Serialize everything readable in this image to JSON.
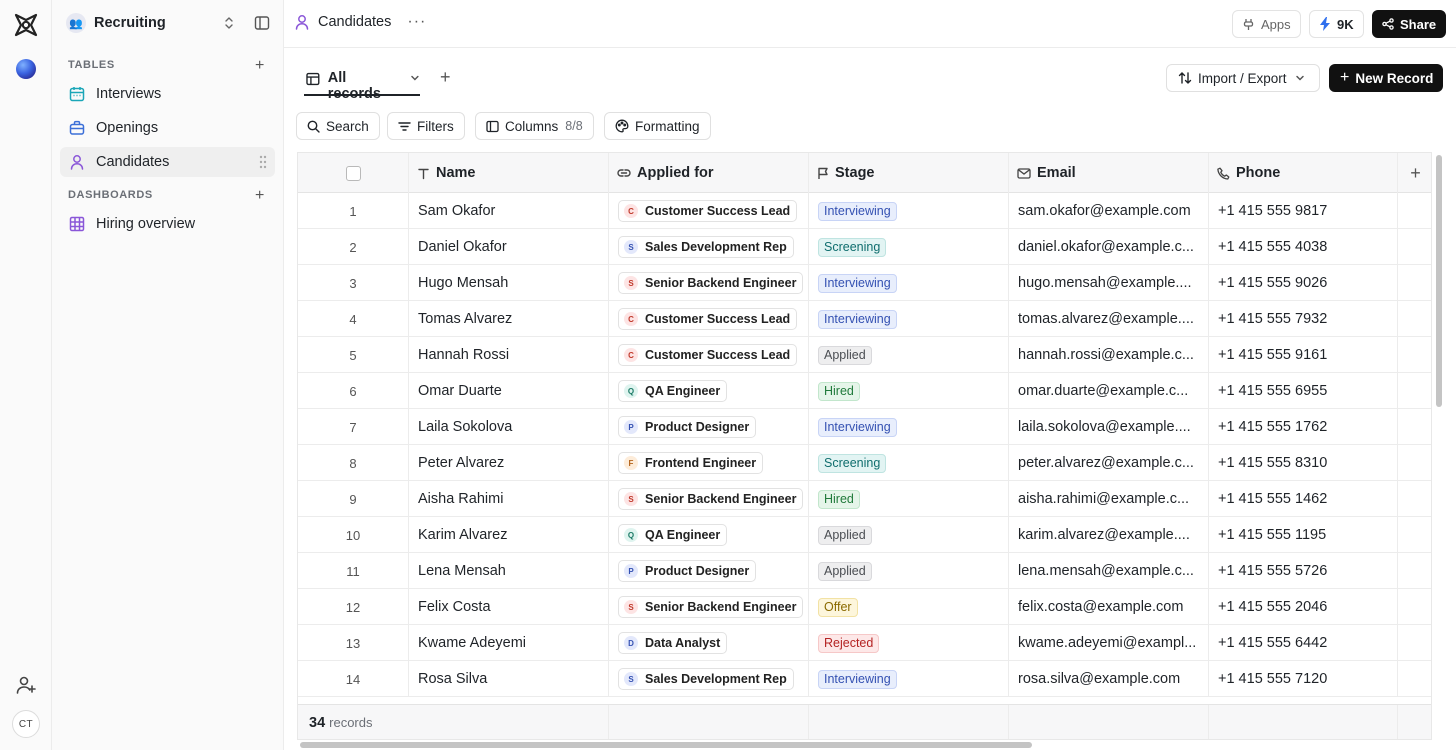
{
  "workspace": {
    "name": "Recruiting",
    "avatar": "👥"
  },
  "sidebar": {
    "tables_header": "TABLES",
    "tables": [
      {
        "label": "Interviews",
        "icon": "calendar-icon",
        "color": "#1aa6b7"
      },
      {
        "label": "Openings",
        "icon": "briefcase-icon",
        "color": "#3b6fd8"
      },
      {
        "label": "Candidates",
        "icon": "person-icon",
        "color": "#8a56d8",
        "active": true
      }
    ],
    "dashboards_header": "DASHBOARDS",
    "dashboards": [
      {
        "label": "Hiring overview",
        "icon": "dashboard-grid-icon",
        "color": "#8a56d8"
      }
    ]
  },
  "rail": {
    "user_initials": "CT"
  },
  "header": {
    "title": "Candidates",
    "apps_label": "Apps",
    "credits_label": "9K",
    "share_label": "Share"
  },
  "view": {
    "name": "All records",
    "import_export_label": "Import / Export",
    "new_record_label": "New Record"
  },
  "toolbar": {
    "search_label": "Search",
    "filters_label": "Filters",
    "columns_label": "Columns",
    "columns_count": "8/8",
    "formatting_label": "Formatting"
  },
  "table": {
    "columns": [
      "Name",
      "Applied for",
      "Stage",
      "Email",
      "Phone"
    ],
    "rows": [
      {
        "n": "1",
        "name": "Sam Okafor",
        "job": "Customer Success Lead",
        "stage": "Interviewing",
        "email": "sam.okafor@example.com",
        "phone": "+1 415 555 9817"
      },
      {
        "n": "2",
        "name": "Daniel Okafor",
        "job": "Sales Development Rep",
        "stage": "Screening",
        "email": "daniel.okafor@example.c...",
        "phone": "+1 415 555 4038"
      },
      {
        "n": "3",
        "name": "Hugo Mensah",
        "job": "Senior Backend Engineer",
        "stage": "Interviewing",
        "email": "hugo.mensah@example....",
        "phone": "+1 415 555 9026"
      },
      {
        "n": "4",
        "name": "Tomas Alvarez",
        "job": "Customer Success Lead",
        "stage": "Interviewing",
        "email": "tomas.alvarez@example....",
        "phone": "+1 415 555 7932"
      },
      {
        "n": "5",
        "name": "Hannah Rossi",
        "job": "Customer Success Lead",
        "stage": "Applied",
        "email": "hannah.rossi@example.c...",
        "phone": "+1 415 555 9161"
      },
      {
        "n": "6",
        "name": "Omar Duarte",
        "job": "QA Engineer",
        "stage": "Hired",
        "email": "omar.duarte@example.c...",
        "phone": "+1 415 555 6955"
      },
      {
        "n": "7",
        "name": "Laila Sokolova",
        "job": "Product Designer",
        "stage": "Interviewing",
        "email": "laila.sokolova@example....",
        "phone": "+1 415 555 1762"
      },
      {
        "n": "8",
        "name": "Peter Alvarez",
        "job": "Frontend Engineer",
        "stage": "Screening",
        "email": "peter.alvarez@example.c...",
        "phone": "+1 415 555 8310"
      },
      {
        "n": "9",
        "name": "Aisha Rahimi",
        "job": "Senior Backend Engineer",
        "stage": "Hired",
        "email": "aisha.rahimi@example.c...",
        "phone": "+1 415 555 1462"
      },
      {
        "n": "10",
        "name": "Karim Alvarez",
        "job": "QA Engineer",
        "stage": "Applied",
        "email": "karim.alvarez@example....",
        "phone": "+1 415 555 1195"
      },
      {
        "n": "11",
        "name": "Lena Mensah",
        "job": "Product Designer",
        "stage": "Applied",
        "email": "lena.mensah@example.c...",
        "phone": "+1 415 555 5726"
      },
      {
        "n": "12",
        "name": "Felix Costa",
        "job": "Senior Backend Engineer",
        "stage": "Offer",
        "email": "felix.costa@example.com",
        "phone": "+1 415 555 2046"
      },
      {
        "n": "13",
        "name": "Kwame Adeyemi",
        "job": "Data Analyst",
        "stage": "Rejected",
        "email": "kwame.adeyemi@exampl...",
        "phone": "+1 415 555 6442"
      },
      {
        "n": "14",
        "name": "Rosa Silva",
        "job": "Sales Development Rep",
        "stage": "Interviewing",
        "email": "rosa.silva@example.com",
        "phone": "+1 415 555 7120"
      }
    ],
    "job_initials": {
      "Customer Success Lead": {
        "letter": "C",
        "bg": "#fde4e4",
        "fg": "#c0392b"
      },
      "Sales Development Rep": {
        "letter": "S",
        "bg": "#e3e8fb",
        "fg": "#3451b2"
      },
      "Senior Backend Engineer": {
        "letter": "S",
        "bg": "#fde4e4",
        "fg": "#c0392b"
      },
      "QA Engineer": {
        "letter": "Q",
        "bg": "#dff4ef",
        "fg": "#1b7a66"
      },
      "Product Designer": {
        "letter": "P",
        "bg": "#e3e8fb",
        "fg": "#3451b2"
      },
      "Frontend Engineer": {
        "letter": "F",
        "bg": "#fdecd9",
        "fg": "#b3631a"
      },
      "Data Analyst": {
        "letter": "D",
        "bg": "#e3e8fb",
        "fg": "#3451b2"
      }
    },
    "footer_count": "34",
    "footer_label": "records"
  }
}
